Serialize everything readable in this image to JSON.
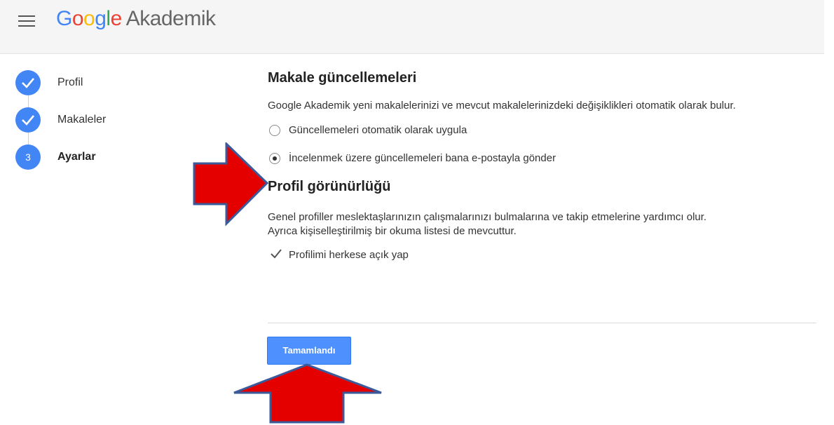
{
  "header": {
    "brand_letters": [
      "G",
      "o",
      "o",
      "g",
      "l",
      "e"
    ],
    "product": "Akademik"
  },
  "icons": {
    "menu": "hamburger-menu-icon",
    "completed_step": "check-icon",
    "checkbox": "checkmark-icon",
    "annotation_arrow": "red-arrow-icon"
  },
  "steps": [
    {
      "label": "Profil",
      "status": "completed"
    },
    {
      "label": "Makaleler",
      "status": "completed"
    },
    {
      "number": "3",
      "label": "Ayarlar",
      "status": "active"
    }
  ],
  "article_updates": {
    "title": "Makale güncellemeleri",
    "description": "Google Akademik yeni makalelerinizi ve mevcut makalelerinizdeki değişiklikleri otomatik olarak bulur.",
    "options": [
      {
        "label": "Güncellemeleri otomatik olarak uygula",
        "selected": false
      },
      {
        "label": "İncelenmek üzere güncellemeleri bana e-postayla gönder",
        "selected": true
      }
    ]
  },
  "profile_visibility": {
    "title": "Profil görünürlüğü",
    "description_line1": "Genel profiller meslektaşlarınızın çalışmalarınızı bulmalarına ve takip etmelerine yardımcı olur.",
    "description_line2": "Ayrıca kişiselleştirilmiş bir okuma listesi de mevcuttur.",
    "public_checkbox_label": "Profilimi herkese açık yap",
    "public_checked": true
  },
  "footer": {
    "done_label": "Tamamlandı"
  },
  "colors": {
    "accent_blue": "#4285f4",
    "button_blue": "#4d90fe",
    "arrow_red": "#e50000",
    "arrow_outline": "#3a5a9a"
  }
}
